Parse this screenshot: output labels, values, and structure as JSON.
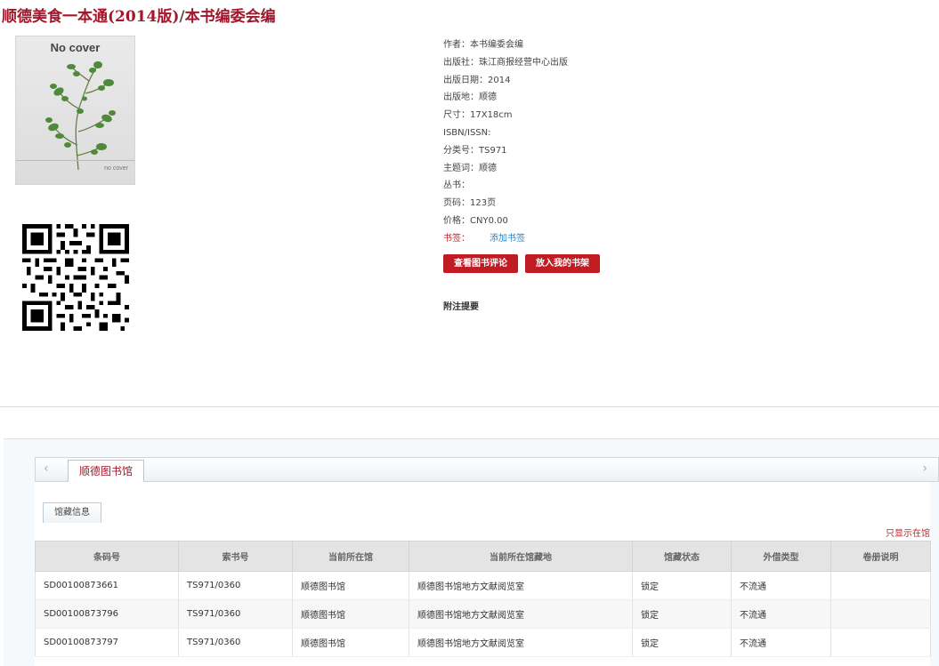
{
  "title": {
    "book": "顺德美食一本通(2014版)",
    "separator": "/",
    "editor": "本书编委会编"
  },
  "cover": {
    "title": "No cover",
    "subtitle": "no cover"
  },
  "meta": {
    "author": "作者：本书编委会编",
    "publisher": "出版社：珠江商报经营中心出版",
    "pub_date": "出版日期：2014",
    "pub_place": "出版地：顺德",
    "size": "尺寸：17X18cm",
    "isbn": "ISBN/ISSN:",
    "class_no": "分类号：TS971",
    "subject": "主题词：顺德",
    "series": "丛书：",
    "pages": "页码：123页",
    "price": "价格：CNY0.00",
    "tag_label": "书签：",
    "tag_link": "添加书签"
  },
  "actions": {
    "review": "查看图书评论",
    "shelf": "放入我的书架"
  },
  "notes_title": "附注提要",
  "holdings": {
    "tab_arrow_left": "‹",
    "tab_arrow_right": "›",
    "library_tab": "顺德图书馆",
    "subtab": "馆藏信息",
    "only_show": "只显示在馆",
    "columns": [
      "条码号",
      "索书号",
      "当前所在馆",
      "当前所在馆藏地",
      "馆藏状态",
      "外借类型",
      "卷册说明"
    ],
    "rows": [
      [
        "SD00100873661",
        "TS971/0360",
        "顺德图书馆",
        "顺德图书馆地方文献阅览室",
        "锁定",
        "不流通",
        ""
      ],
      [
        "SD00100873796",
        "TS971/0360",
        "顺德图书馆",
        "顺德图书馆地方文献阅览室",
        "锁定",
        "不流通",
        ""
      ],
      [
        "SD00100873797",
        "TS971/0360",
        "顺德图书馆",
        "顺德图书馆地方文献阅览室",
        "锁定",
        "不流通",
        ""
      ]
    ]
  },
  "colors": {
    "title": "#a3162b",
    "button": "#c11b24",
    "link": "#2b84c6",
    "plant": "#4e8a3a"
  }
}
